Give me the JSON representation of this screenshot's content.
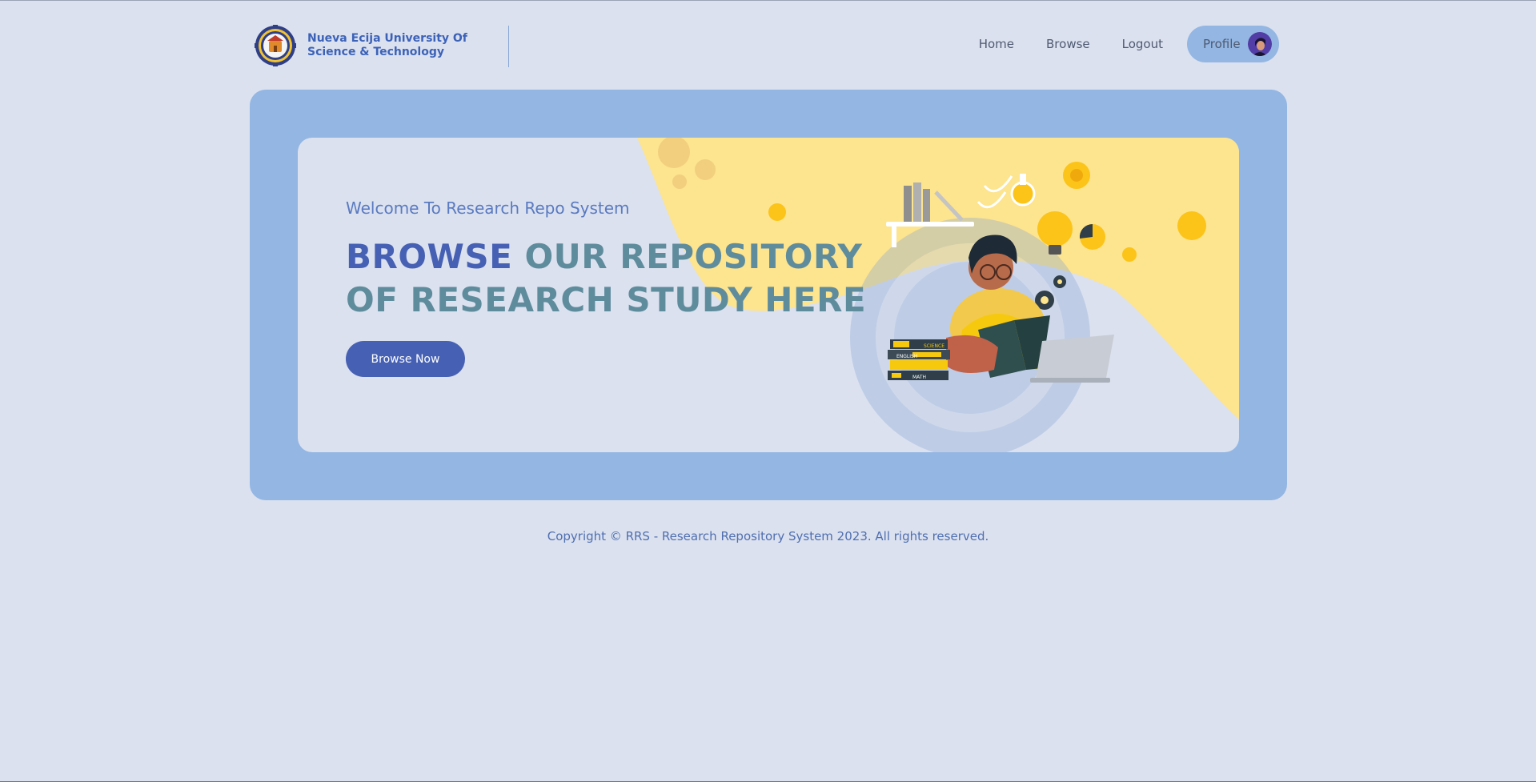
{
  "header": {
    "brand_name": "Nueva Ecija University Of Science & Technology",
    "logo_icon": "university-seal-logo",
    "nav": {
      "home": "Home",
      "browse": "Browse",
      "logout": "Logout",
      "profile": "Profile"
    },
    "avatar_icon": "user-avatar"
  },
  "hero": {
    "welcome": "Welcome To Research Repo System",
    "headline_strong": "BROWSE",
    "headline_rest": "OUR REPOSITORY OF RESEARCH STUDY HERE",
    "cta_label": "Browse Now",
    "illustration_icon": "student-reading-illustration",
    "book_labels": [
      "SCIENCE",
      "ENGLISH",
      "MATH"
    ]
  },
  "footer": {
    "copyright": "Copyright © RRS - Research Repository System 2023. All rights reserved."
  },
  "colors": {
    "page_bg": "#dbe1ef",
    "hero_outer": "#93b6e3",
    "accent_blue": "#4660b4",
    "accent_teal": "#5f8c9d",
    "yellow_wave": "#fde48f",
    "yellow_dot": "#fcc419"
  }
}
